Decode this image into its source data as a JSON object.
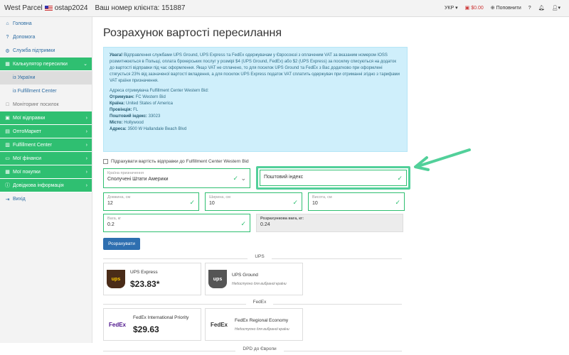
{
  "topbar": {
    "brand": "West Parcel",
    "username": "ostap2024",
    "client_label": "Ваш номер клієнта: 151887",
    "lang": "УКР",
    "balance": "$0.00",
    "topup": "Поповнити",
    "help": "?",
    "accent_color": "#2fbf71"
  },
  "sidebar": {
    "items": [
      {
        "label": "Головна",
        "icon": "home-icon"
      },
      {
        "label": "Допомога",
        "icon": "question-icon"
      },
      {
        "label": "Служба підтримки",
        "icon": "support-icon"
      },
      {
        "label": "Калькулятор пересилки",
        "icon": "calculator-icon"
      },
      {
        "label": "із України"
      },
      {
        "label": "із Fulfillment Center"
      },
      {
        "label": "Моніторинг посилок",
        "icon": "monitor-icon"
      },
      {
        "label": "Мої відправки",
        "icon": "box-icon"
      },
      {
        "label": "ОптоМаркет",
        "icon": "cart-icon"
      },
      {
        "label": "Fulfillment Center",
        "icon": "warehouse-icon"
      },
      {
        "label": "Мої фінанси",
        "icon": "wallet-icon"
      },
      {
        "label": "Мої покупки",
        "icon": "shopping-icon"
      },
      {
        "label": "Довідкова інформація",
        "icon": "info-icon"
      },
      {
        "label": "Вихід",
        "icon": "logout-icon"
      }
    ]
  },
  "main": {
    "title": "Розрахунок вартості пересилання",
    "info": {
      "warning_strong": "Увага!",
      "warning_text": " Відправлення службами UPS Ground, UPS Express та FedEx одержувачам у Євросоюзі з оплаченим VAT за вказаним номером IOSS розмитнюються в Польщі, оплата брокерських послуг у розмірі $4 (UPS Ground, FedEx) або $2 (UPS Express) за посилку списуються на додаток до вартості відправки під час оформлення. Якщо VAT не сплачено, то для посилок UPS Ground та FedEx з Вас додатково при оформлені стягується 23% від зазначеної вартості вкладення, а для посилок UPS Express податок VAT сплатить одержувач при отриманні згідно з тарифами VAT країни призначення.",
      "address_title": "Адреса отримувача Fulfillment Center Western Bid:",
      "recipient_label": "Отримувач:",
      "recipient": "FC Western Bid",
      "country_label": "Країна:",
      "country": "United States of America",
      "province_label": "Провінція:",
      "province": "FL",
      "zip_label": "Поштовий індекс:",
      "zip": "33023",
      "city_label": "Місто:",
      "city": "Hollywood",
      "address_label": "Адреса:",
      "address": "3500 W Hallandale Beach Blvd"
    },
    "checkbox_label": "Підрахувати вартість відправки до Fulfillment Center Western Bid",
    "form": {
      "country_label": "Країна призначення",
      "country_value": "Сполучені Штати Америки",
      "zip_placeholder": "Поштовий індекс",
      "length_label": "Довжина, см",
      "length_value": "12",
      "width_label": "Ширина, см",
      "width_value": "10",
      "height_label": "Висота, см",
      "height_value": "10",
      "weight_label": "Вага, кг",
      "weight_value": "0.2",
      "calc_weight_label": "Розрахункова вага, кг:",
      "calc_weight_value": "0.24",
      "submit": "Розрахувати"
    },
    "sections": [
      {
        "title": "UPS",
        "carriers": [
          {
            "name": "UPS Express",
            "logo": "ups",
            "price": "$23.83*"
          },
          {
            "name": "UPS Ground",
            "logo": "ups",
            "note": "Недоступно для вибраної країни"
          }
        ]
      },
      {
        "title": "FedEx",
        "carriers": [
          {
            "name": "FedEx International Priority",
            "logo": "FedEx",
            "price": "$29.63"
          },
          {
            "name": "FedEx Regional Economy",
            "logo": "FedEx",
            "note": "Недоступно для вибраної країни"
          }
        ]
      },
      {
        "title": "DPD до Європи",
        "carriers": []
      }
    ]
  }
}
